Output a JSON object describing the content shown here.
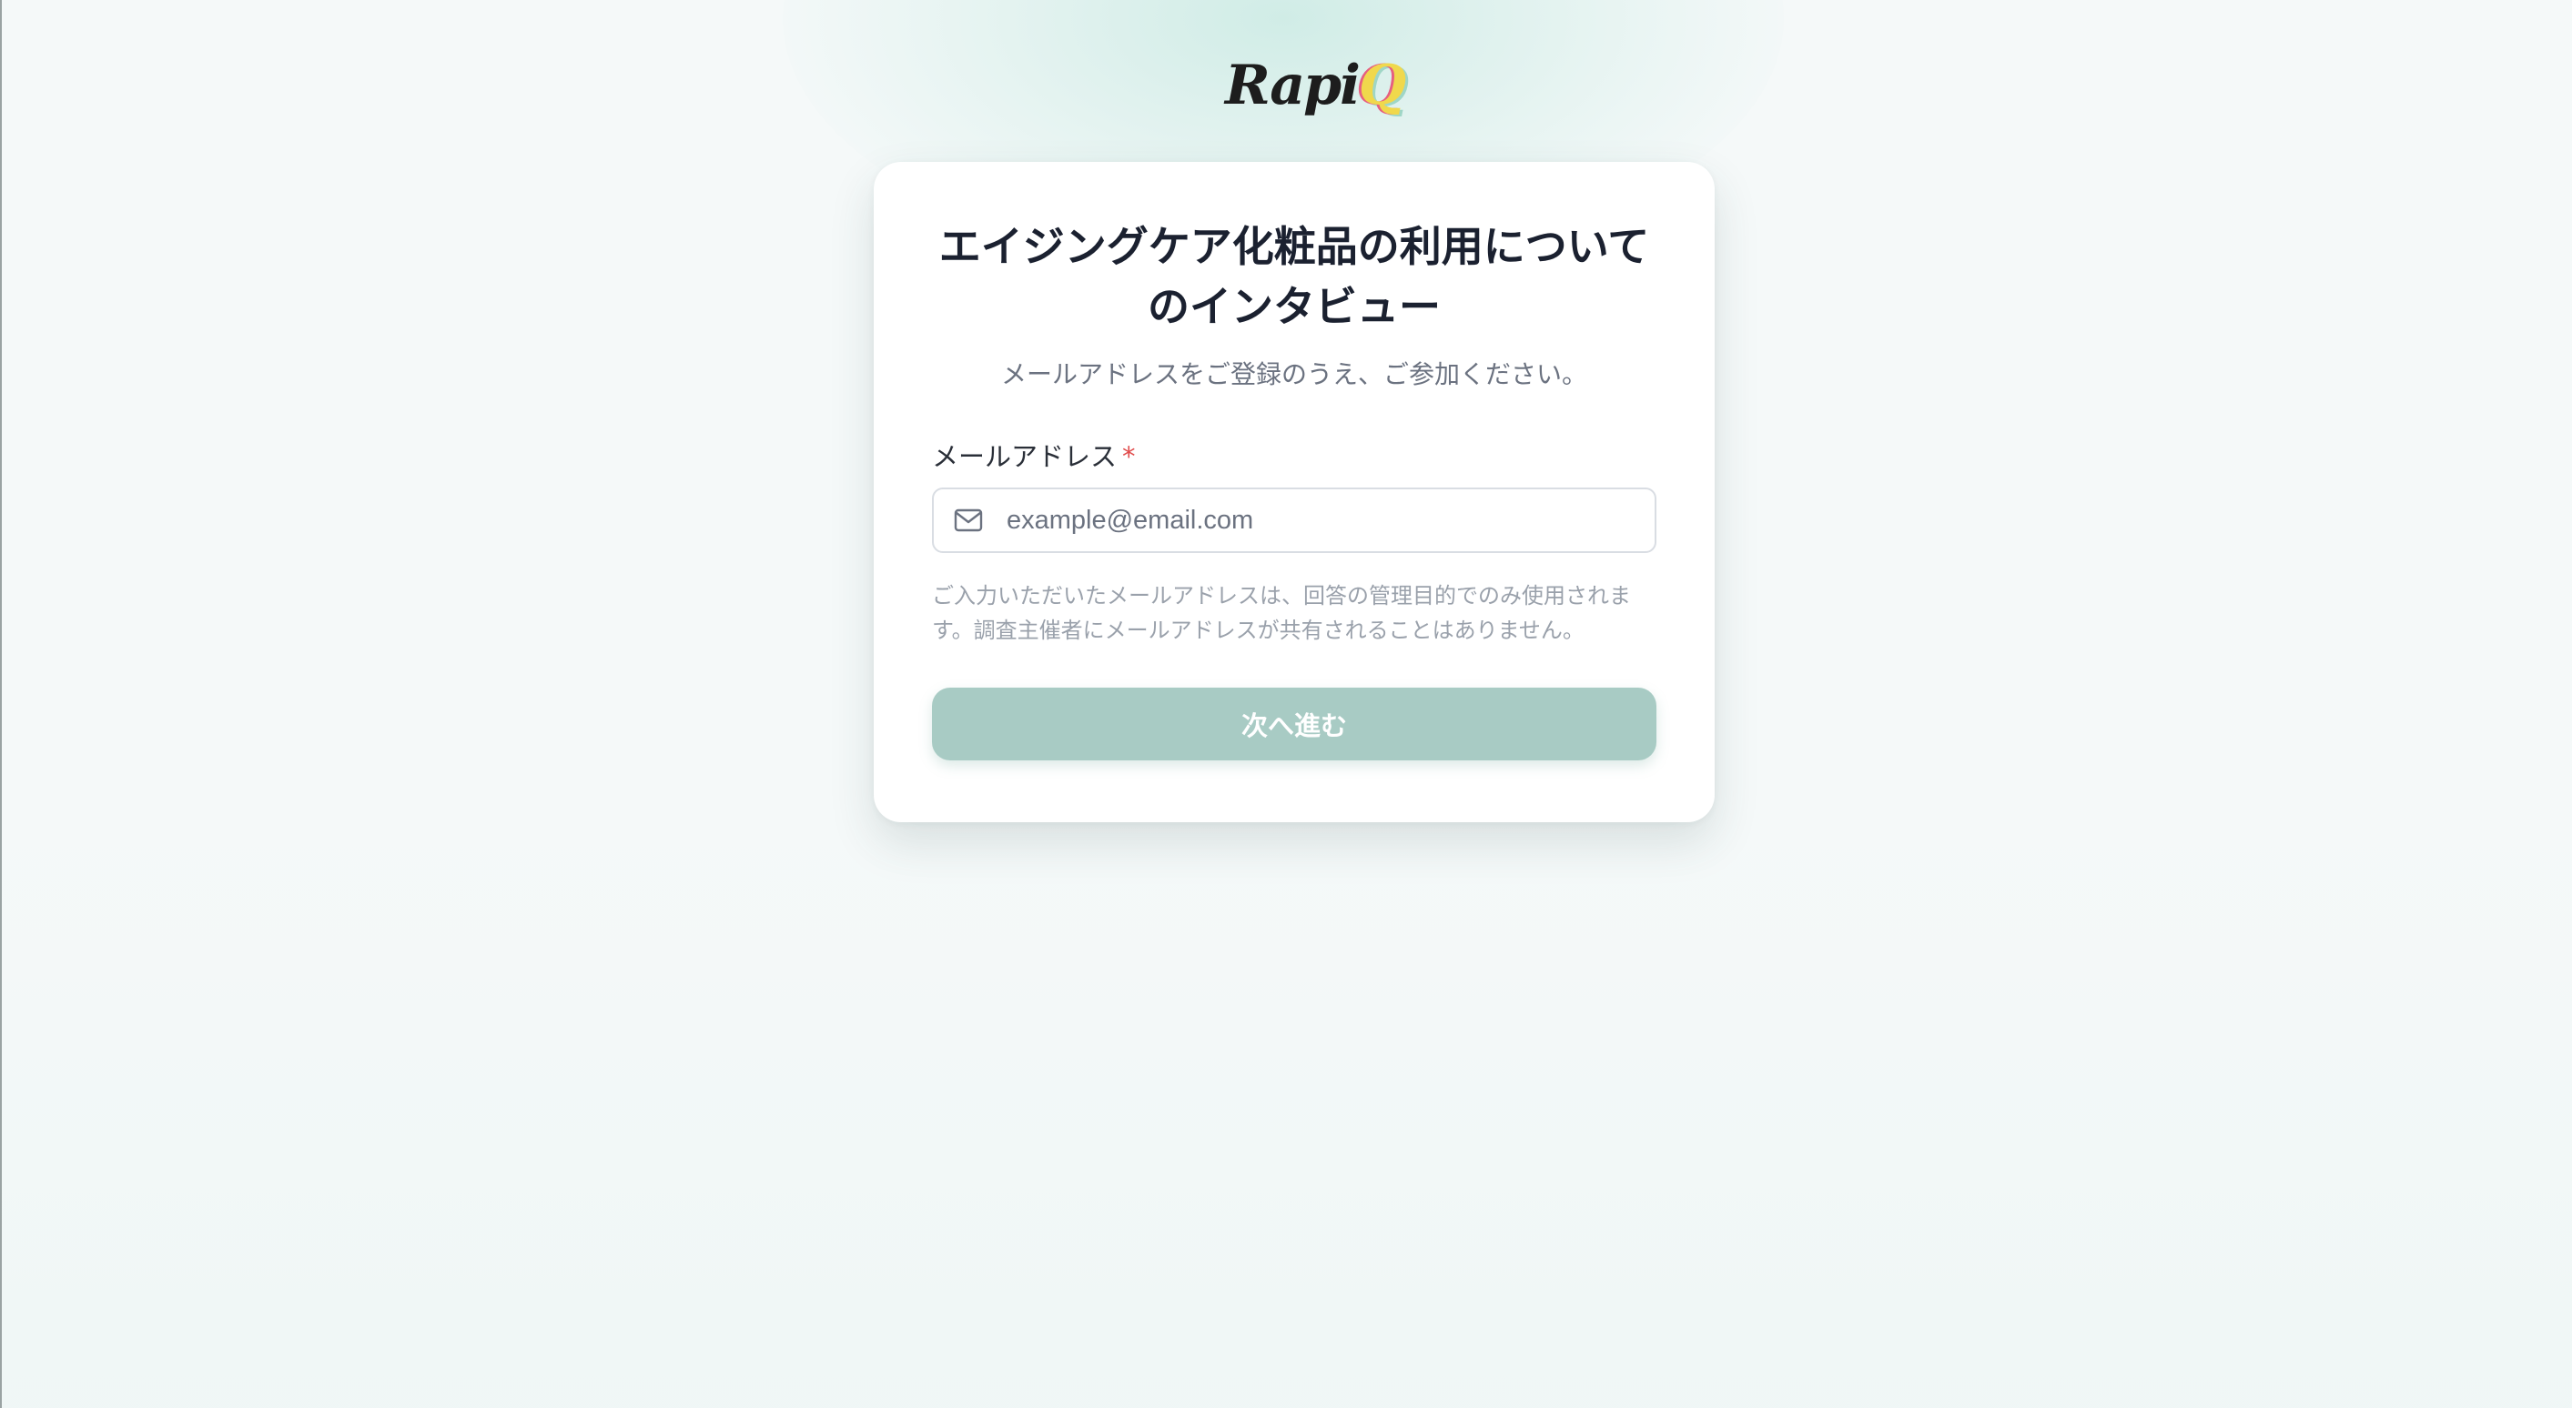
{
  "brand": {
    "logo_text": "Rapi",
    "logo_mark": "Q"
  },
  "survey": {
    "title": "エイジングケア化粧品の利用についてのインタビュー",
    "subtitle": "メールアドレスをご登録のうえ、ご参加ください。"
  },
  "form": {
    "email_label": "メールアドレス",
    "required_mark": "*",
    "email_value": "",
    "email_placeholder": "example@email.com",
    "privacy_note": "ご入力いただいたメールアドレスは、回答の管理目的でのみ使用されます。調査主催者にメールアドレスが共有されることはありません。",
    "next_label": "次へ進む"
  },
  "icons": {
    "email_field_icon": "mail-icon"
  },
  "colors": {
    "button_bg": "#a8cbc4",
    "required": "#e04b4b",
    "title_text": "#1b2130"
  }
}
